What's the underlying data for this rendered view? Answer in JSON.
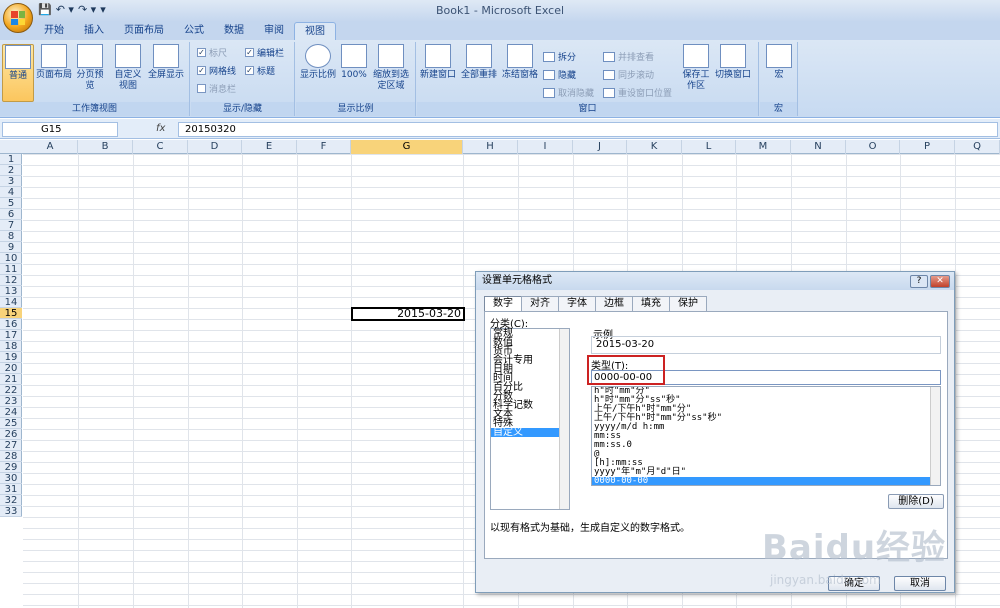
{
  "window": {
    "title": "Book1 - Microsoft Excel"
  },
  "qat": {
    "save": "💾",
    "undo": "↶ ▾",
    "redo": "↷ ▾",
    "more": "▾"
  },
  "tabs": [
    "开始",
    "插入",
    "页面布局",
    "公式",
    "数据",
    "审阅",
    "视图"
  ],
  "ribbon": {
    "workbook_views": {
      "label": "工作簿视图",
      "buttons": [
        "普通",
        "页面布局",
        "分页预览",
        "自定义视图",
        "全屏显示"
      ]
    },
    "show_hide": {
      "label": "显示/隐藏",
      "ruler": "标尺",
      "gridlines": "网格线",
      "messagebar": "消息栏",
      "formulabar": "编辑栏",
      "headings": "标题"
    },
    "zoom": {
      "label": "显示比例",
      "buttons": [
        "显示比例",
        "100%",
        "缩放到选定区域"
      ]
    },
    "window": {
      "label": "窗口",
      "new_window": "新建窗口",
      "arrange_all": "全部重排",
      "freeze": "冻结窗格",
      "split": "拆分",
      "hide": "隐藏",
      "unhide": "取消隐藏",
      "side_by_side": "并排查看",
      "sync_scroll": "同步滚动",
      "reset_pos": "重设窗口位置",
      "save_ws": "保存工作区",
      "switch": "切换窗口"
    },
    "macros": {
      "label": "宏",
      "button": "宏"
    }
  },
  "formula_bar": {
    "name_box": "G15",
    "fx": "fx",
    "value": "20150320"
  },
  "sheet": {
    "columns": [
      "A",
      "B",
      "C",
      "D",
      "E",
      "F",
      "G",
      "H",
      "I",
      "J",
      "K",
      "L",
      "M",
      "N",
      "O",
      "P",
      "Q"
    ],
    "rows": [
      "1",
      "2",
      "3",
      "4",
      "5",
      "6",
      "7",
      "8",
      "9",
      "10",
      "11",
      "12",
      "13",
      "14",
      "15",
      "16",
      "17",
      "18",
      "19",
      "20",
      "21",
      "22",
      "23",
      "24",
      "25",
      "26",
      "27",
      "28",
      "29",
      "30",
      "31",
      "32",
      "33"
    ],
    "active_cell_value": "2015-03-20"
  },
  "dialog": {
    "title": "设置单元格格式",
    "help": "?",
    "close": "✕",
    "tabs": [
      "数字",
      "对齐",
      "字体",
      "边框",
      "填充",
      "保护"
    ],
    "category_label": "分类(C):",
    "categories": [
      "常规",
      "数值",
      "货币",
      "会计专用",
      "日期",
      "时间",
      "百分比",
      "分数",
      "科学记数",
      "文本",
      "特殊",
      "自定义"
    ],
    "sample_label": "示例",
    "sample_value": "2015-03-20",
    "type_label": "类型(T):",
    "type_value": "0000-00-00",
    "formats": [
      "h\"时\"mm\"分\"",
      "h\"时\"mm\"分\"ss\"秒\"",
      "上午/下午h\"时\"mm\"分\"",
      "上午/下午h\"时\"mm\"分\"ss\"秒\"",
      "yyyy/m/d h:mm",
      "mm:ss",
      "mm:ss.0",
      "@",
      "[h]:mm:ss",
      "yyyy\"年\"m\"月\"d\"日\"",
      "0000-00-00"
    ],
    "delete_button": "删除(D)",
    "description": "以现有格式为基础，生成自定义的数字格式。",
    "ok": "确定",
    "cancel": "取消"
  },
  "watermark": {
    "brand": "Baidu经验",
    "url": "jingyan.baidu.com"
  }
}
